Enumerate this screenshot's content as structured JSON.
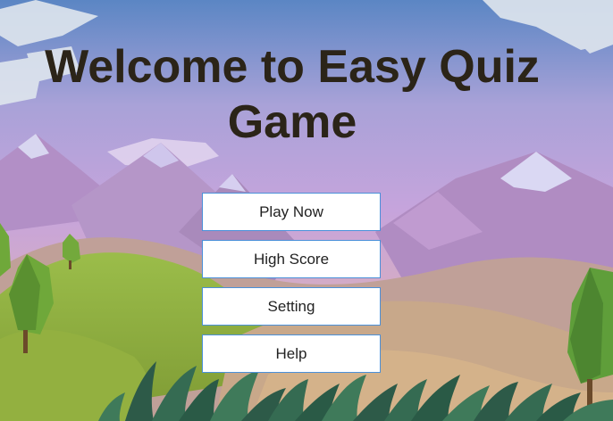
{
  "title": {
    "line1": "Welcome to Easy Quiz",
    "line2": "Game"
  },
  "menu": {
    "items": [
      {
        "label": "Play Now"
      },
      {
        "label": "High Score"
      },
      {
        "label": "Setting"
      },
      {
        "label": "Help"
      }
    ]
  },
  "colors": {
    "sky_top": "#5b86c4",
    "sky_mid": "#c6a4dc",
    "sky_bottom": "#e8b89a",
    "title_text": "#2b2418",
    "button_border": "#4a90d9",
    "hill_green": "#8fae3c",
    "grass_dark": "#2e5a4a"
  }
}
